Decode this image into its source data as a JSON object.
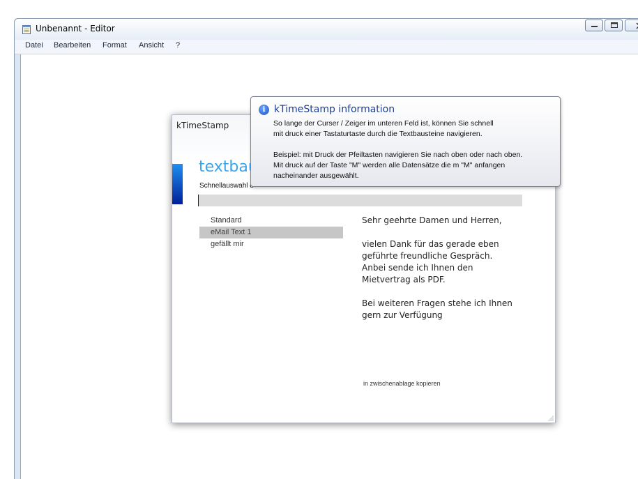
{
  "notepad": {
    "title": "Unbenannt - Editor",
    "menu": [
      "Datei",
      "Bearbeiten",
      "Format",
      "Ansicht",
      "?"
    ]
  },
  "ktimestamp": {
    "window_title": "kTimeStamp",
    "heading": "textbaus",
    "subtitle": "Schnellauswahl d",
    "search_value": "",
    "list_items": [
      "Standard",
      "eMail Text 1",
      "gefällt mir"
    ],
    "selected_index": 1,
    "preview": [
      "Sehr geehrte Damen und Herren,",
      "",
      "vielen Dank für das gerade eben geführte freundliche Gespräch. Anbei sende ich Ihnen den Mietvertrag als PDF.",
      "",
      "Bei weiteren Fragen stehe ich Ihnen gern zur Verfügung"
    ],
    "copy_link": "in zwischenablage kopieren"
  },
  "tooltip": {
    "title": "kTimeStamp information",
    "lines": [
      "So lange der Curser / Zeiger im unteren Feld ist, können Sie schnell",
      "mit druck einer Tastaturtaste durch die Textbausteine navigieren.",
      "",
      "Beispiel: mit Druck der Pfeiltasten navigieren Sie nach oben oder nach oben.",
      "Mit druck auf der Taste \"M\" werden alle Datensätze die m \"M\" anfangen",
      "nacheinander ausgewählt."
    ]
  },
  "colors": {
    "accent_blue": "#3aa3ea",
    "selection_gray": "#c6c6c6",
    "tooltip_title": "#1c3f94"
  }
}
